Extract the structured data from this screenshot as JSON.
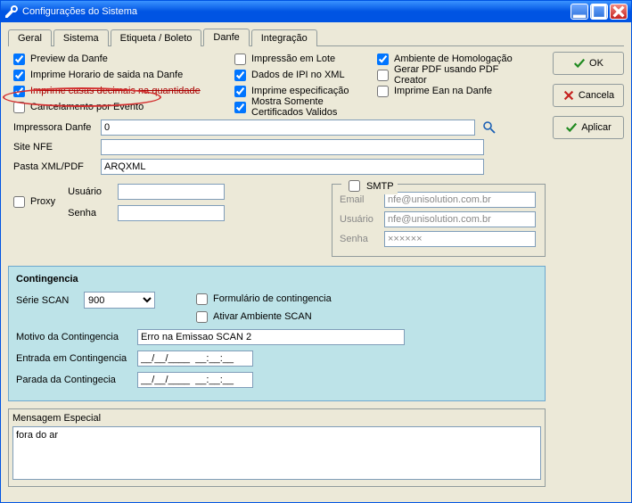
{
  "window": {
    "title": "Configurações do Sistema"
  },
  "tabs": [
    "Geral",
    "Sistema",
    "Etiqueta / Boleto",
    "Danfe",
    "Integração"
  ],
  "active_tab": "Danfe",
  "buttons": {
    "ok": "OK",
    "cancel": "Cancela",
    "apply": "Aplicar"
  },
  "checks": {
    "col1": [
      {
        "label": "Preview da Danfe",
        "checked": true
      },
      {
        "label": "Imprime Horario de  saida na Danfe",
        "checked": true
      },
      {
        "label": "Imprime casas decimais na  quantidade",
        "checked": true,
        "strike": true
      },
      {
        "label": "Cancelamento por Evento",
        "checked": false,
        "highlight": true
      }
    ],
    "col2": [
      {
        "label": "Impressão em Lote",
        "checked": false
      },
      {
        "label": "Dados de IPI no XML",
        "checked": true
      },
      {
        "label": "Imprime especificação",
        "checked": true
      },
      {
        "label": "Mostra Somente Certificados Validos",
        "checked": true
      }
    ],
    "col3": [
      {
        "label": "Ambiente de Homologação",
        "checked": true
      },
      {
        "label": "Gerar PDF usando PDF Creator",
        "checked": false
      },
      {
        "label": "Imprime Ean na Danfe",
        "checked": false
      }
    ]
  },
  "fields": {
    "impressora_label": "Impressora Danfe",
    "impressora_value": "0",
    "site_nfe_label": "Site NFE",
    "site_nfe_value": "",
    "pasta_label": "Pasta XML/PDF",
    "pasta_value": "ARQXML"
  },
  "proxy": {
    "label": "Proxy",
    "checked": false,
    "usuario_label": "Usuário",
    "usuario_value": "",
    "senha_label": "Senha",
    "senha_value": ""
  },
  "smtp": {
    "legend": "SMTP",
    "checked": false,
    "email_label": "Email",
    "email_value": "nfe@unisolution.com.br",
    "usuario_label": "Usuário",
    "usuario_value": "nfe@unisolution.com.br",
    "senha_label": "Senha",
    "senha_value": "××××××"
  },
  "contingencia": {
    "title": "Contingencia",
    "serie_label": "Série SCAN",
    "serie_value": "900",
    "formulario_label": "Formulário de contingencia",
    "formulario_checked": false,
    "ativar_label": "Ativar Ambiente SCAN",
    "ativar_checked": false,
    "motivo_label": "Motivo da Contingencia",
    "motivo_value": "Erro na Emissao SCAN 2",
    "entrada_label": "Entrada em Contingencia",
    "entrada_value": "__/__/____  __:__:__",
    "parada_label": "Parada da Contingecia",
    "parada_value": "__/__/____  __:__:__"
  },
  "mensagem": {
    "label": "Mensagem Especial",
    "value": "fora do ar"
  }
}
